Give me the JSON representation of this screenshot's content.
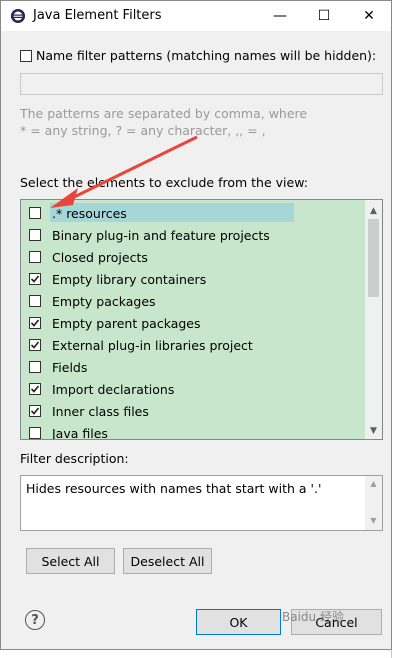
{
  "window": {
    "title": "Java Element Filters",
    "minimize": "—",
    "maximize": "☐",
    "close": "✕"
  },
  "name_filter": {
    "label": "Name filter patterns (matching names will be hidden):",
    "checked": false,
    "value": ""
  },
  "hint": {
    "line1": "The patterns are separated by comma, where",
    "line2": "* = any string, ? = any character, ,, = ,"
  },
  "elements": {
    "label": "Select the elements to exclude from the view:",
    "items": [
      {
        "label": ".* resources",
        "checked": false,
        "selected": true
      },
      {
        "label": "Binary plug-in and feature projects",
        "checked": false
      },
      {
        "label": "Closed projects",
        "checked": false
      },
      {
        "label": "Empty library containers",
        "checked": true
      },
      {
        "label": "Empty packages",
        "checked": false
      },
      {
        "label": "Empty parent packages",
        "checked": true
      },
      {
        "label": "External plug-in libraries project",
        "checked": true
      },
      {
        "label": "Fields",
        "checked": false
      },
      {
        "label": "Import declarations",
        "checked": true
      },
      {
        "label": "Inner class files",
        "checked": true
      },
      {
        "label": "Java files",
        "checked": false
      }
    ]
  },
  "description": {
    "label": "Filter description:",
    "text": "Hides resources with names that start with a '.'"
  },
  "buttons": {
    "select_all": "Select All",
    "deselect_all": "Deselect All",
    "ok": "OK",
    "cancel": "Cancel"
  },
  "colors": {
    "list_bg": "#c8e6cc",
    "selection": "#a6d7d8",
    "annotation_arrow": "#e8463a"
  },
  "watermark": "Baidu 经验"
}
